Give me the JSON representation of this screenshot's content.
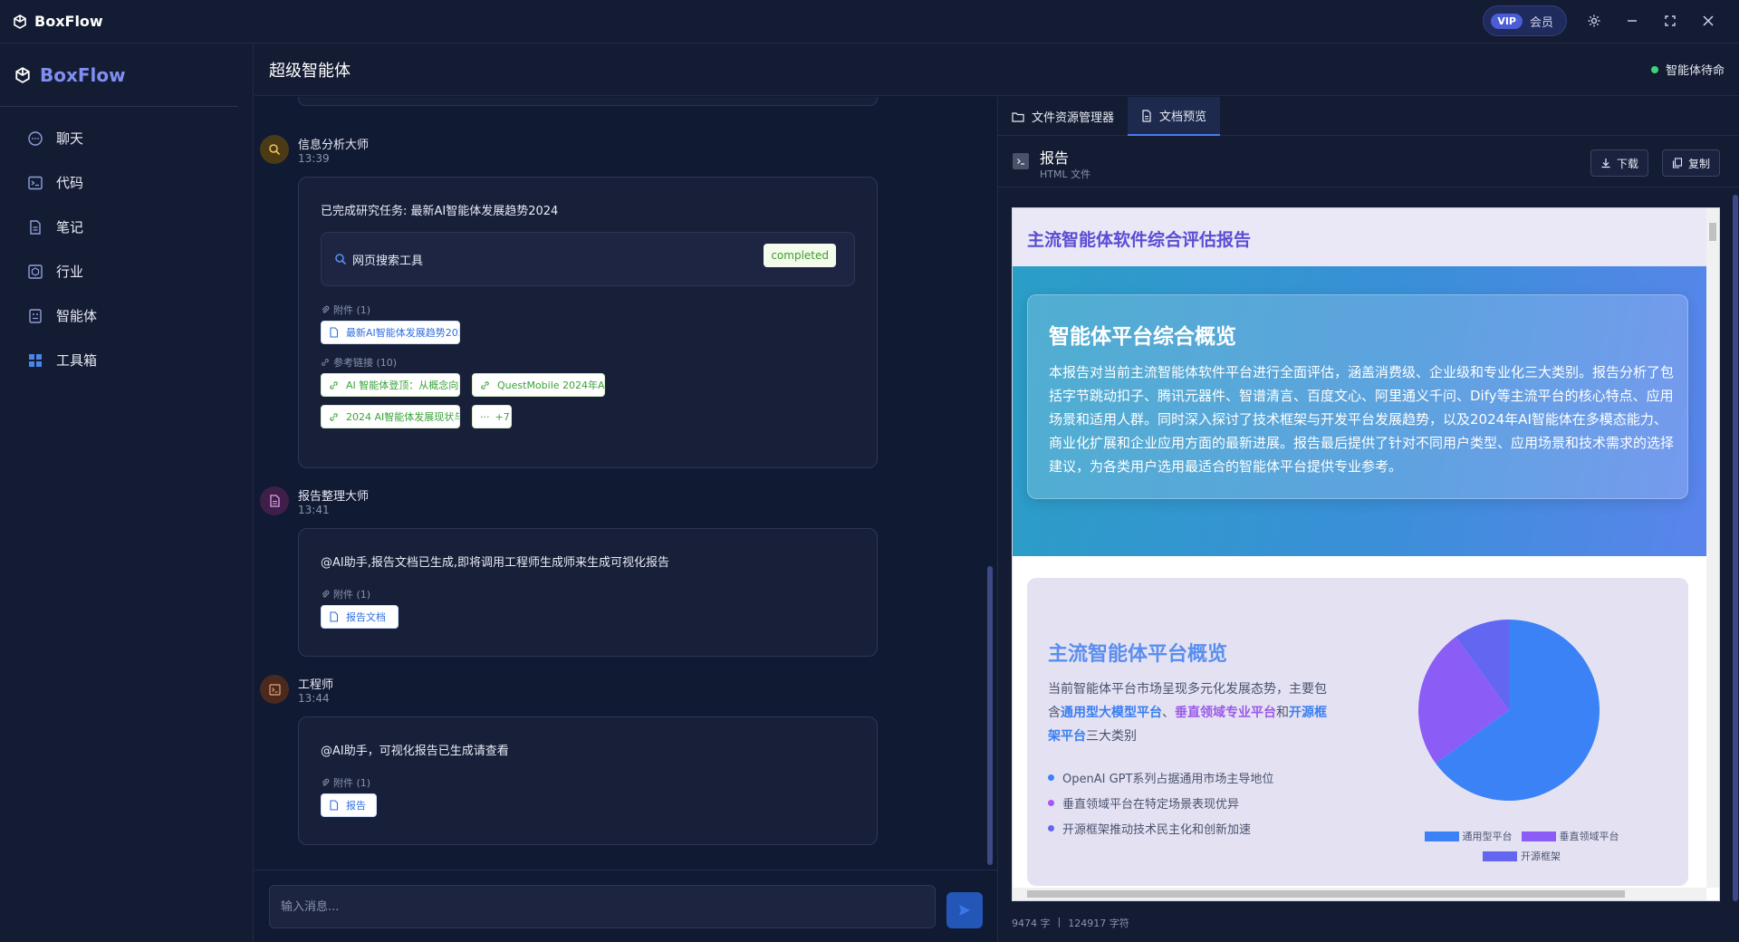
{
  "app": {
    "title": "BoxFlow"
  },
  "titlebar": {
    "vip_tag": "VIP",
    "vip_label": "会员"
  },
  "sidebar": {
    "brand": "BoxFlow",
    "items": [
      {
        "label": "聊天",
        "icon": "chat-icon"
      },
      {
        "label": "代码",
        "icon": "terminal-icon"
      },
      {
        "label": "笔记",
        "icon": "document-icon"
      },
      {
        "label": "行业",
        "icon": "industry-icon"
      },
      {
        "label": "智能体",
        "icon": "agent-icon"
      },
      {
        "label": "工具箱",
        "icon": "toolbox-icon"
      }
    ]
  },
  "header": {
    "title": "超级智能体",
    "status": "智能体待命"
  },
  "chat": {
    "messages": [
      {
        "author": "信息分析大师",
        "time": "13:39",
        "text": "已完成研究任务: 最新AI智能体发展趋势2024",
        "tool": {
          "name": "网页搜索工具",
          "status": "completed"
        },
        "attachments_label": "附件 (1)",
        "attachments": [
          "最新AI智能体发展趋势202..."
        ],
        "links_label": "参考链接 (10)",
        "links": [
          "AI 智能体登顶：从概念向...",
          "QuestMobile 2024年AI智...",
          "2024 AI智能体发展现状与...",
          "+7"
        ]
      },
      {
        "author": "报告整理大师",
        "time": "13:41",
        "text": "@AI助手,报告文档已生成,即将调用工程师生成师来生成可视化报告",
        "attachments_label": "附件 (1)",
        "attachments": [
          "报告文档"
        ]
      },
      {
        "author": "工程师",
        "time": "13:44",
        "text": "@AI助手，可视化报告已生成请查看",
        "attachments_label": "附件 (1)",
        "attachments": [
          "报告"
        ]
      }
    ],
    "input_placeholder": "输入消息..."
  },
  "panel": {
    "tabs": [
      {
        "label": "文件资源管理器",
        "icon": "folder-icon",
        "active": false
      },
      {
        "label": "文档预览",
        "icon": "document-icon",
        "active": true
      }
    ],
    "file": {
      "name": "报告",
      "type": "HTML 文件",
      "download_label": "下载",
      "copy_label": "复制"
    },
    "stats": {
      "words": "9474 字",
      "sep": "|",
      "chars": "124917 字符"
    }
  },
  "preview": {
    "header_title": "主流智能体软件综合评估报告",
    "card1": {
      "title": "智能体平台综合概览",
      "body": "本报告对当前主流智能体软件平台进行全面评估，涵盖消费级、企业级和专业化三大类别。报告分析了包括字节跳动扣子、腾讯元器件、智谱清言、百度文心、阿里通义千问、Dify等主流平台的核心特点、应用场景和适用人群。同时深入探讨了技术框架与开发平台发展趋势，以及2024年AI智能体在多模态能力、商业化扩展和企业应用方面的最新进展。报告最后提供了针对不同用户类型、应用场景和技术需求的选择建议，为各类用户选用最适合的智能体平台提供专业参考。"
    },
    "card2": {
      "title": "主流智能体平台概览",
      "intro_pre": "当前智能体平台市场呈现多元化发展态势，主要包含",
      "hl1": "通用型大模型平台",
      "sep1": "、",
      "hl2": "垂直领域专业平台",
      "mid": "和",
      "hl3": "开源框架平台",
      "post": "三大类别",
      "bullets": [
        {
          "text": "OpenAI GPT系列占据通用市场主导地位",
          "color": "#3b82f6"
        },
        {
          "text": "垂直领域平台在特定场景表现优异",
          "color": "#a855f7"
        },
        {
          "text": "开源框架推动技术民主化和创新加速",
          "color": "#6366f1"
        }
      ]
    }
  },
  "chart_data": {
    "type": "pie",
    "categories": [
      "通用型平台",
      "垂直领域平台",
      "开源框架"
    ],
    "values": [
      65,
      25,
      10
    ],
    "colors": [
      "#3b82f6",
      "#8b5cf6",
      "#6366f1"
    ],
    "legend_position": "bottom"
  }
}
